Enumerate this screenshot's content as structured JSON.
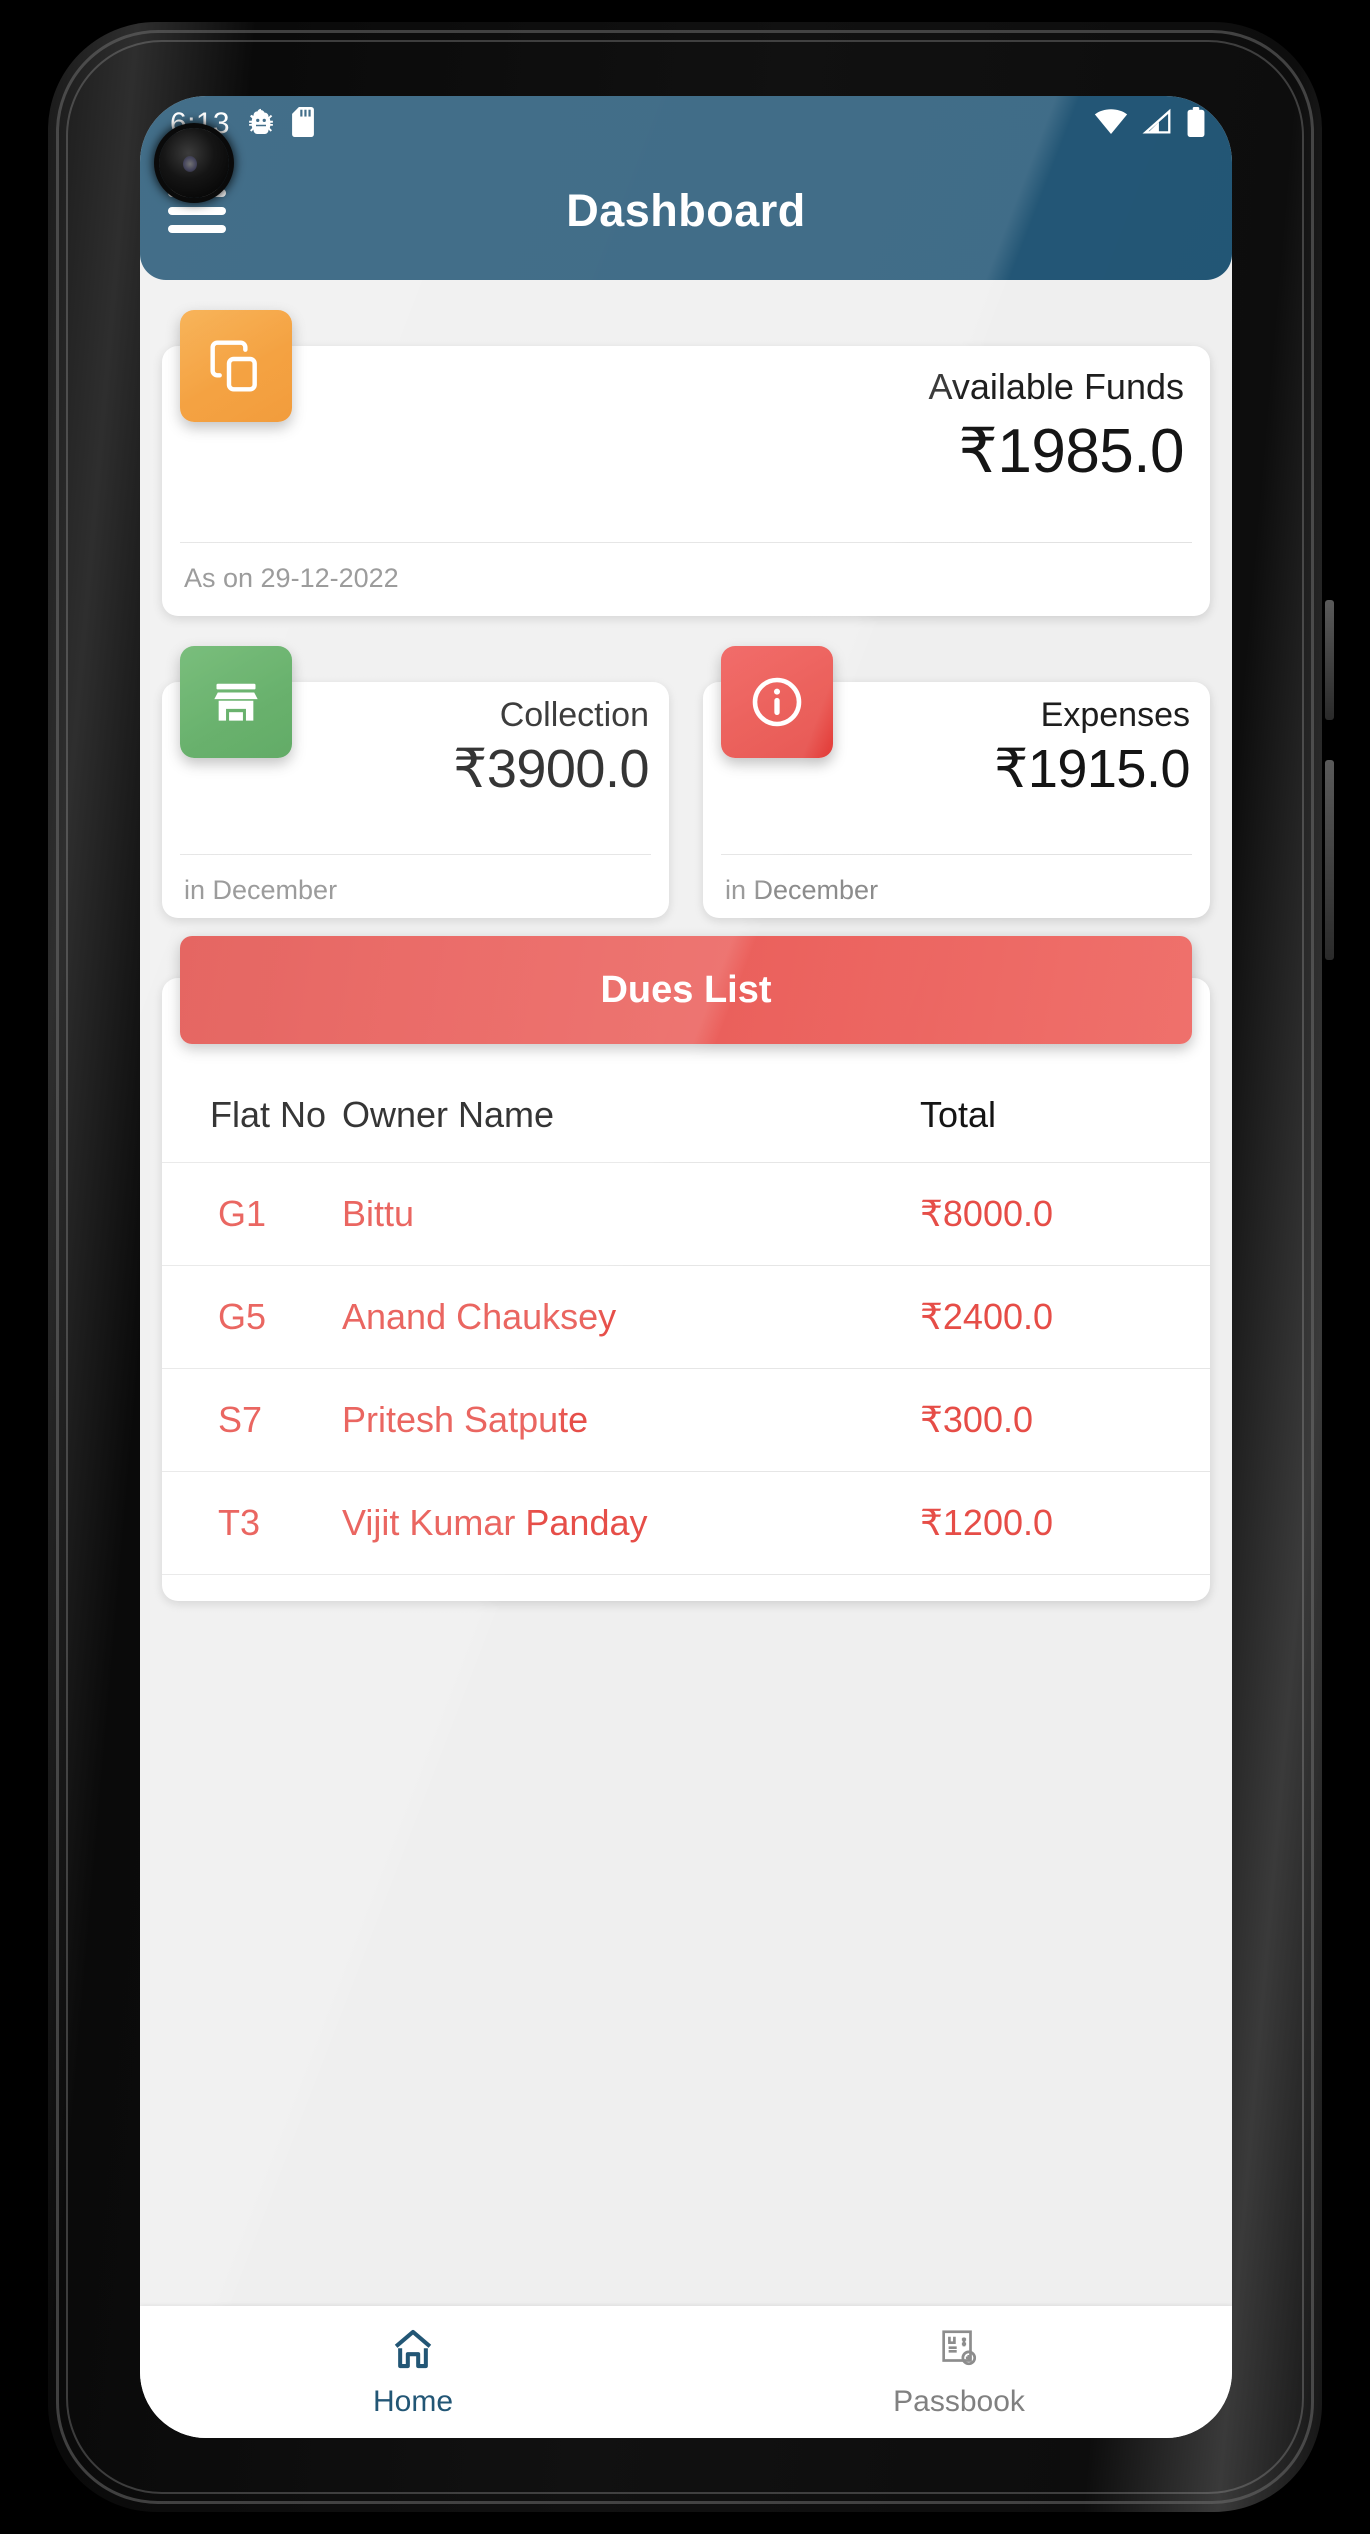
{
  "statusbar": {
    "time": "6:13",
    "icons_left": [
      "android-debug-icon",
      "sd-card-icon"
    ],
    "icons_right": [
      "wifi-icon",
      "cellular-signal-icon",
      "battery-icon"
    ]
  },
  "appbar": {
    "title": "Dashboard",
    "menu_icon": "hamburger-menu-icon",
    "background_color": "#1f5373"
  },
  "funds_card": {
    "icon": "copy-layers-icon",
    "icon_color": "#f2911f",
    "label": "Available Funds",
    "amount": "₹1985.0",
    "note": "As on 29-12-2022"
  },
  "collection_card": {
    "icon": "store-icon",
    "icon_color": "#4da352",
    "label": "Collection",
    "amount": "₹3900.0",
    "note": "in December"
  },
  "expenses_card": {
    "icon": "info-circle-icon",
    "icon_color": "#e8453f",
    "label": "Expenses",
    "amount": "₹1915.0",
    "note": "in December"
  },
  "dues": {
    "header": "Dues List",
    "header_color": "#e85450",
    "columns": [
      "Flat No",
      "Owner Name",
      "Total"
    ],
    "rows": [
      {
        "flat": "G1",
        "owner": "Bittu",
        "total": "₹8000.0"
      },
      {
        "flat": "G5",
        "owner": "Anand Chauksey",
        "total": "₹2400.0"
      },
      {
        "flat": "S7",
        "owner": "Pritesh Satpute",
        "total": "₹300.0"
      },
      {
        "flat": "T3",
        "owner": "Vijit Kumar Panday",
        "total": "₹1200.0"
      }
    ]
  },
  "bottom_nav": {
    "items": [
      {
        "label": "Home",
        "icon": "home-icon",
        "active": true
      },
      {
        "label": "Passbook",
        "icon": "passbook-receipt-icon",
        "active": false
      }
    ],
    "active_color": "#1f5373",
    "inactive_color": "#808080"
  }
}
